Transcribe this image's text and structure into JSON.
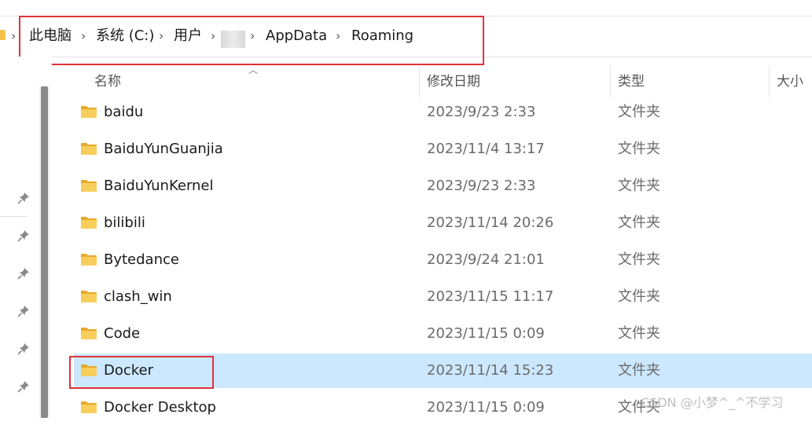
{
  "breadcrumb": {
    "items": [
      "此电脑",
      "系统 (C:)",
      "用户",
      "AppData",
      "Roaming"
    ],
    "separator": "›"
  },
  "columns": {
    "name": "名称",
    "modified": "修改日期",
    "type": "类型",
    "size": "大小"
  },
  "rows": [
    {
      "name": "baidu",
      "modified": "2023/9/23 2:33",
      "type": "文件夹"
    },
    {
      "name": "BaiduYunGuanjia",
      "modified": "2023/11/4 13:17",
      "type": "文件夹"
    },
    {
      "name": "BaiduYunKernel",
      "modified": "2023/9/23 2:33",
      "type": "文件夹"
    },
    {
      "name": "bilibili",
      "modified": "2023/11/14 20:26",
      "type": "文件夹"
    },
    {
      "name": "Bytedance",
      "modified": "2023/9/24 21:01",
      "type": "文件夹"
    },
    {
      "name": "clash_win",
      "modified": "2023/11/15 11:17",
      "type": "文件夹"
    },
    {
      "name": "Code",
      "modified": "2023/11/15 0:09",
      "type": "文件夹"
    },
    {
      "name": "Docker",
      "modified": "2023/11/14 15:23",
      "type": "文件夹",
      "selected": true
    },
    {
      "name": "Docker Desktop",
      "modified": "2023/11/15 0:09",
      "type": "文件夹"
    }
  ],
  "watermark": "CSDN @小梦^_^不学习",
  "colors": {
    "selection": "#cce8ff",
    "highlight_box": "#e0323a",
    "folder": "#f3c14a"
  }
}
